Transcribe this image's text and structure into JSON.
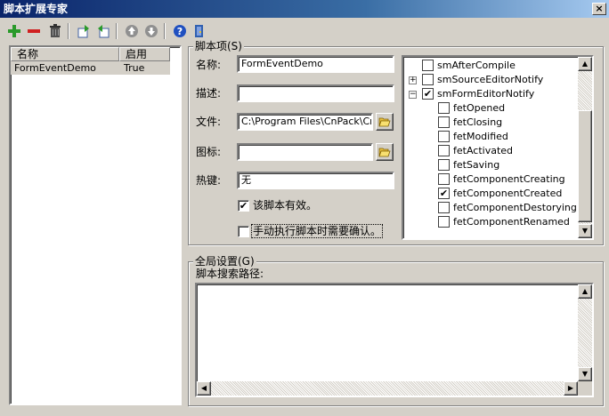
{
  "window": {
    "title": "脚本扩展专家",
    "close_glyph": "×"
  },
  "toolbar": {
    "icons": [
      "add-icon",
      "remove-icon",
      "delete-icon",
      "import-icon",
      "export-icon",
      "move-up-icon",
      "move-down-icon",
      "help-icon",
      "exit-icon"
    ]
  },
  "script_list": {
    "columns": [
      "名称",
      "启用"
    ],
    "rows": [
      {
        "name": "FormEventDemo",
        "enabled": "True"
      }
    ]
  },
  "script_item": {
    "legend": "脚本项(S)",
    "name_label": "名称:",
    "name_value": "FormEventDemo",
    "desc_label": "描述:",
    "desc_value": "",
    "file_label": "文件:",
    "file_value": "C:\\Program Files\\CnPack\\CnWi",
    "icon_label": "图标:",
    "icon_value": "",
    "hotkey_label": "热键:",
    "hotkey_value": "无",
    "valid_label": "该脚本有效。",
    "valid_checked": true,
    "confirm_label": "手动执行脚本时需要确认。",
    "confirm_checked": false
  },
  "event_tree": [
    {
      "label": "smAfterCompile",
      "checked": false,
      "level": 0,
      "expander": ""
    },
    {
      "label": "smSourceEditorNotify",
      "checked": false,
      "level": 0,
      "expander": "+"
    },
    {
      "label": "smFormEditorNotify",
      "checked": true,
      "level": 0,
      "expander": "−"
    },
    {
      "label": "fetOpened",
      "checked": false,
      "level": 1,
      "expander": ""
    },
    {
      "label": "fetClosing",
      "checked": false,
      "level": 1,
      "expander": ""
    },
    {
      "label": "fetModified",
      "checked": false,
      "level": 1,
      "expander": ""
    },
    {
      "label": "fetActivated",
      "checked": false,
      "level": 1,
      "expander": ""
    },
    {
      "label": "fetSaving",
      "checked": false,
      "level": 1,
      "expander": ""
    },
    {
      "label": "fetComponentCreating",
      "checked": false,
      "level": 1,
      "expander": ""
    },
    {
      "label": "fetComponentCreated",
      "checked": true,
      "level": 1,
      "expander": ""
    },
    {
      "label": "fetComponentDestorying",
      "checked": false,
      "level": 1,
      "expander": ""
    },
    {
      "label": "fetComponentRenamed",
      "checked": false,
      "level": 1,
      "expander": ""
    }
  ],
  "global": {
    "legend": "全局设置(G)",
    "path_label": "脚本搜索路径:",
    "path_value": ""
  },
  "colors": {
    "title_start": "#0a246a",
    "title_end": "#a6caf0",
    "face": "#d4d0c8"
  }
}
